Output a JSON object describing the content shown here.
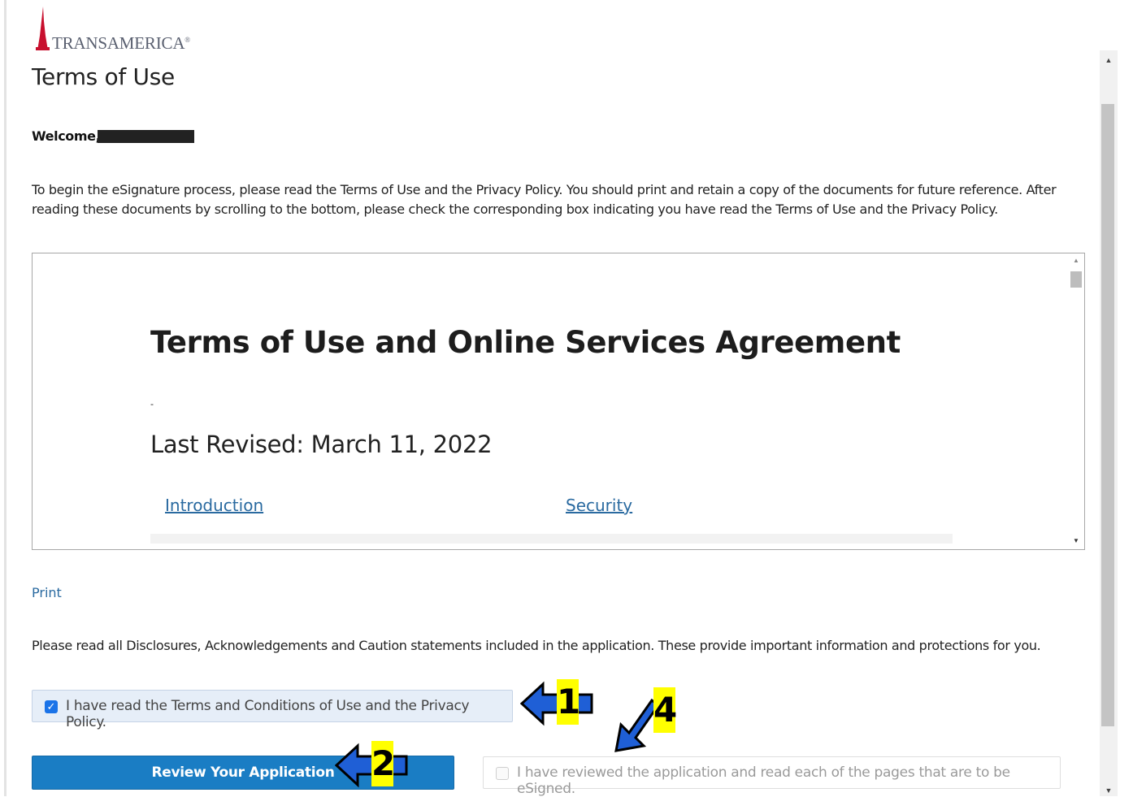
{
  "brand": {
    "name": "Transamerica",
    "accent_red": "#c8102e"
  },
  "page": {
    "title": "Terms of Use",
    "welcome_label": "Welcome,",
    "intro_text": "To begin the eSignature process, please read the Terms of Use and the Privacy Policy. You should print and retain a copy of the documents for future reference.   After reading these documents by scrolling to the bottom, please check the corresponding box indicating you have read the Terms of Use and the Privacy Policy."
  },
  "document": {
    "title": "Terms of Use and Online Services Agreement",
    "dash": "-",
    "last_revised": "Last Revised: March 11, 2022",
    "links": [
      "Introduction",
      "Security"
    ]
  },
  "print_label": "Print",
  "disclosure_text": "Please read all Disclosures, Acknowledgements and Caution statements included in the application.  These provide important information and protections for you.",
  "terms_checkbox": {
    "label": "I have read the Terms and Conditions of Use and the Privacy Policy.",
    "checked": true
  },
  "review_button": {
    "label": "Review Your Application",
    "color": "#1a7dc4"
  },
  "reviewed_checkbox": {
    "label": "I have reviewed the application and read each of the pages that are to be eSigned.",
    "checked": false,
    "disabled": true
  },
  "annotations": [
    {
      "number": "1",
      "highlight": "#ffff00",
      "arrow_color": "#1f5fd6"
    },
    {
      "number": "2",
      "highlight": "#ffff00",
      "arrow_color": "#1f5fd6"
    },
    {
      "number": "4",
      "highlight": "#ffff00",
      "arrow_color": "#1f5fd6"
    }
  ]
}
